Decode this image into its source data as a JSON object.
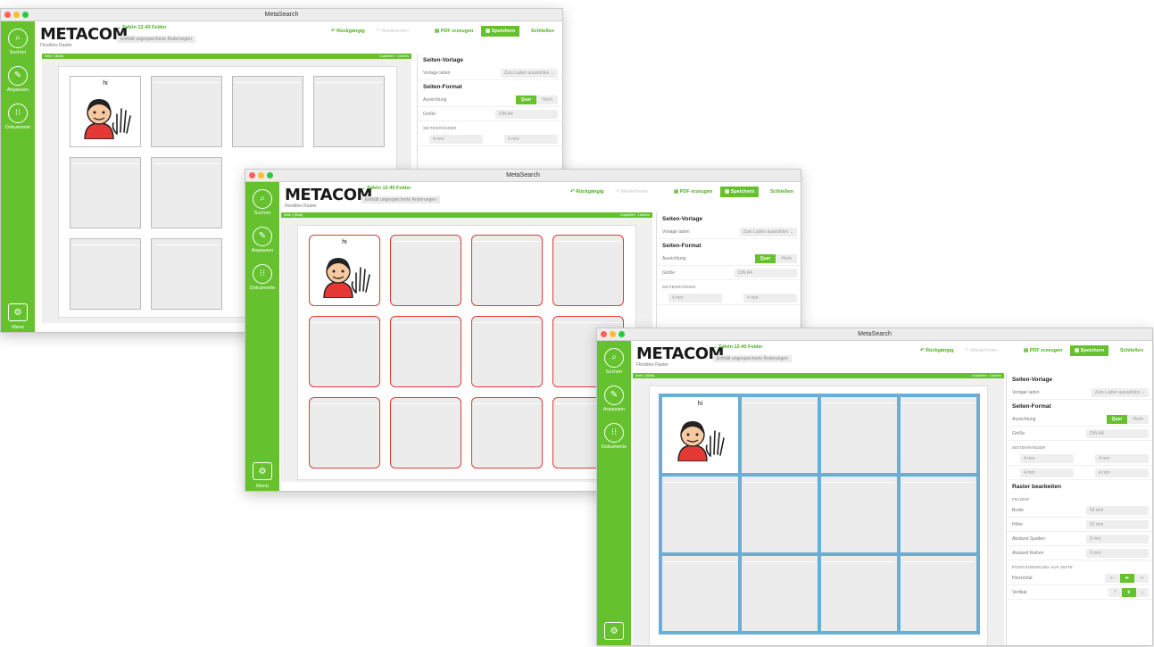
{
  "windows": [
    {
      "title": "MetaSearch",
      "sidebar": {
        "items": [
          {
            "label": "Suchen"
          },
          {
            "label": "Anpassen"
          },
          {
            "label": "Dokumente"
          }
        ],
        "menu_label": "Menü"
      },
      "header": {
        "logo": "METACOM",
        "sublogo": "Flexibles Raster",
        "template": "Tafeln 12-40 Felder",
        "unsaved": "Enthält ungespeicherte Änderungen"
      },
      "toolbar": {
        "undo": "Rückgängig",
        "redo": "Wiederholen",
        "pdf": "PDF erzeugen",
        "save": "Speichern",
        "close": "Schließen"
      },
      "canvas": {
        "strip_left": "Seite 1 (Blatt)",
        "strip_right": "Kopfzeilen · Löschen",
        "cell_text": "hi",
        "border_style": "default"
      },
      "panel": {
        "section_template": "Seiten-Vorlage",
        "template_label": "Vorlage laden",
        "template_value": "Zum Laden auswählen",
        "section_format": "Seiten-Format",
        "orientation_label": "Ausrichtung",
        "quer": "Quer",
        "hoch": "Hoch",
        "size_label": "Größe",
        "size_value": "DIN A4",
        "margins_cap": "SEITENRÄNDER",
        "margin_value": "4 mm"
      }
    },
    {
      "title": "MetaSearch",
      "sidebar": {
        "items": [
          {
            "label": "Suchen"
          },
          {
            "label": "Anpassen"
          },
          {
            "label": "Dokumente"
          }
        ],
        "menu_label": "Menü"
      },
      "header": {
        "logo": "METACOM",
        "sublogo": "Flexibles Raster",
        "template": "Tafeln 12-40 Felder",
        "unsaved": "Enthält ungespeicherte Änderungen"
      },
      "toolbar": {
        "undo": "Rückgängig",
        "redo": "Wiederholen",
        "pdf": "PDF erzeugen",
        "save": "Speichern",
        "close": "Schließen"
      },
      "canvas": {
        "strip_left": "Seite 1 (Blatt)",
        "strip_right": "Kopfzeilen · Löschen",
        "cell_text": "hi",
        "border_style": "red-rounded"
      },
      "panel": {
        "section_template": "Seiten-Vorlage",
        "template_label": "Vorlage laden",
        "template_value": "Zum Laden auswählen",
        "section_format": "Seiten-Format",
        "orientation_label": "Ausrichtung",
        "quer": "Quer",
        "hoch": "Hoch",
        "size_label": "Größe",
        "size_value": "DIN A4",
        "margins_cap": "SEITENRÄNDER",
        "margin_value": "4 mm"
      }
    },
    {
      "title": "MetaSearch",
      "sidebar": {
        "items": [
          {
            "label": "Suchen"
          },
          {
            "label": "Anpassen"
          },
          {
            "label": "Dokumente"
          }
        ],
        "menu_label": "Menü"
      },
      "header": {
        "logo": "METACOM",
        "sublogo": "Flexibles Raster",
        "template": "Tafeln 12-40 Felder",
        "unsaved": "Enthält ungespeicherte Änderungen"
      },
      "toolbar": {
        "undo": "Rückgängig",
        "redo": "Wiederholen",
        "pdf": "PDF erzeugen",
        "save": "Speichern",
        "close": "Schließen"
      },
      "canvas": {
        "strip_left": "Seite 1 (Blatt)",
        "strip_right": "Kopfzeilen · Löschen",
        "cell_text": "hi",
        "border_style": "blue-grid"
      },
      "panel": {
        "section_template": "Seiten-Vorlage",
        "template_label": "Vorlage laden",
        "template_value": "Zum Laden auswählen",
        "section_format": "Seiten-Format",
        "orientation_label": "Ausrichtung",
        "quer": "Quer",
        "hoch": "Hoch",
        "size_label": "Größe",
        "size_value": "DIN A4",
        "margins_cap": "SEITENRÄNDER",
        "margin_value": "4 mm",
        "section_grid": "Raster bearbeiten",
        "fields_cap": "FELDER",
        "width_label": "Breite",
        "width_value": "64 mm",
        "height_label": "Höhe",
        "height_value": "63 mm",
        "col_gap_label": "Abstand Spalten",
        "col_gap_value": "0 mm",
        "row_gap_label": "Abstand Reihen",
        "row_gap_value": "0 mm",
        "position_cap": "POSITIONIERUNG AUF SEITE",
        "horizontal_label": "Horizontal",
        "vertical_label": "Vertikal"
      }
    }
  ],
  "colors": {
    "accent": "#65c22e",
    "red_border": "#e33a3a",
    "blue_grid": "#6aaed6",
    "sidebar": "#65c22e"
  }
}
